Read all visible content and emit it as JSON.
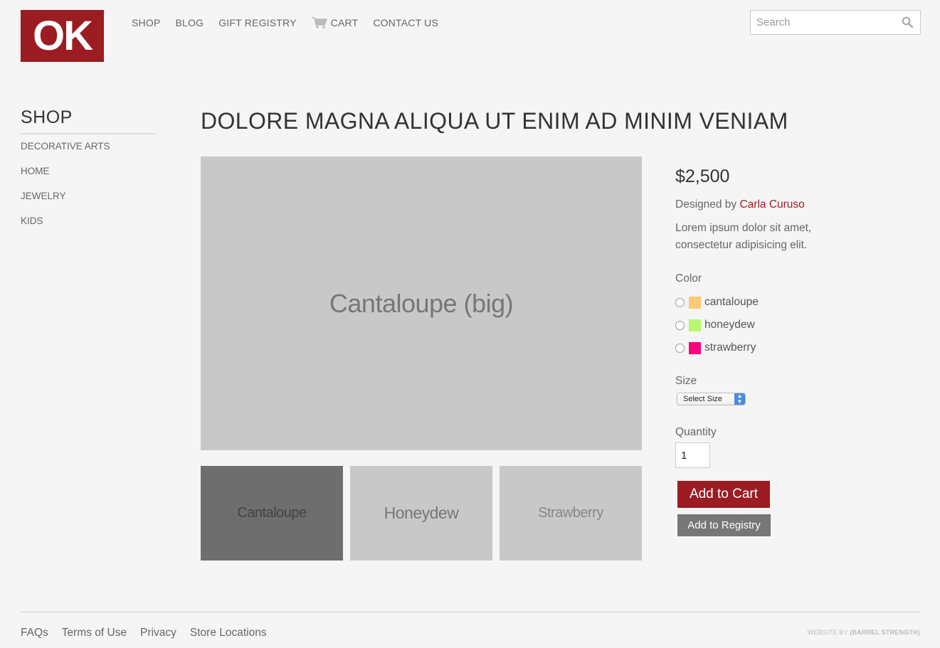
{
  "header": {
    "logo_text": "OK",
    "nav": [
      "SHOP",
      "BLOG",
      "GIFT REGISTRY",
      "CART",
      "CONTACT US"
    ],
    "search_placeholder": "Search"
  },
  "sidebar": {
    "title": "SHOP",
    "items": [
      "DECORATIVE ARTS",
      "HOME",
      "JEWELRY",
      "KIDS"
    ]
  },
  "product": {
    "title": "DOLORE MAGNA ALIQUA UT ENIM AD MINIM VENIAM",
    "main_image_label": "Cantaloupe (big)",
    "thumbnails": [
      "Cantaloupe",
      "Honeydew",
      "Strawberry"
    ],
    "price": "$2,500",
    "designed_by_prefix": "Designed by",
    "designer": "Carla Curuso",
    "description": "Lorem ipsum dolor sit amet, consectetur adipisicing elit.",
    "color_label": "Color",
    "colors": [
      {
        "name": "cantaloupe",
        "hex": "#ffc977"
      },
      {
        "name": "honeydew",
        "hex": "#b8f76e"
      },
      {
        "name": "strawberry",
        "hex": "#f7047a"
      }
    ],
    "size_label": "Size",
    "size_select": "Select Size",
    "quantity_label": "Quantity",
    "quantity": "1",
    "add_to_cart": "Add to Cart",
    "add_to_registry": "Add to Registry"
  },
  "footer": {
    "links": [
      "FAQs",
      "Terms of Use",
      "Privacy",
      "Store Locations"
    ],
    "credit_prefix": "WEBSITE BY",
    "credit_name": "(BARREL STRENGTH)"
  },
  "colors": {
    "brand": "#9b1c22",
    "background": "#f5f5f5",
    "image_placeholder": "#c8c8c8"
  }
}
